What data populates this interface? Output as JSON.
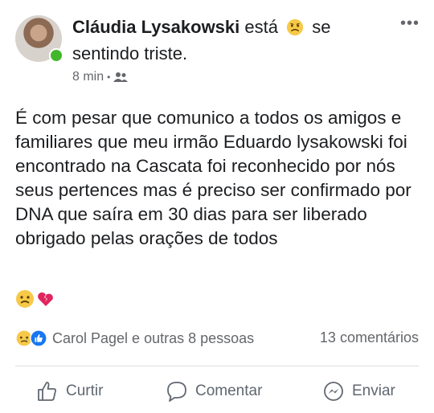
{
  "post": {
    "author": "Cláudia Lysakowski",
    "verb": "está",
    "feeling_pre": "se",
    "feeling_line2": "sentindo triste.",
    "feeling_icon": "sad-face-emoji",
    "time": "8 min",
    "audience_icon": "friends-icon",
    "more_label": "•••",
    "text": "É com pesar que comunico a todos os amigos e familiares que meu irmão Eduardo lysakowski foi encontrado na Cascata foi reconhecido por nós seus pertences mas é preciso ser confirmado por DNA que saíra em 30 dias para ser liberado obrigado pelas orações de todos",
    "trailing_emojis": [
      "sad-face-emoji",
      "broken-heart-emoji"
    ]
  },
  "reactions": {
    "icons": [
      "sad-reaction-icon",
      "like-reaction-icon"
    ],
    "summary": "Carol Pagel e outras 8 pessoas",
    "comments": "13 comentários"
  },
  "actions": {
    "like_label": "Curtir",
    "comment_label": "Comentar",
    "share_label": "Enviar"
  },
  "colors": {
    "text": "#1c1e21",
    "secondary": "#65676b",
    "online": "#42b72a",
    "like_blue": "#1877f2",
    "divider": "#dadde1"
  }
}
